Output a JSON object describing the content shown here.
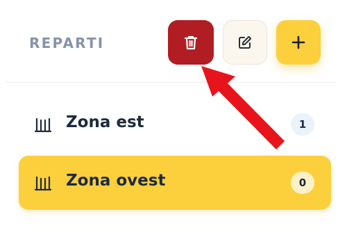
{
  "header": {
    "title": "REPARTI",
    "delete_icon": "trash-icon",
    "edit_icon": "pencil-icon",
    "add_icon": "plus-icon",
    "delete_color": "#b01d23",
    "add_color": "#fcd03d"
  },
  "departments": [
    {
      "label": "Zona est",
      "count": "1",
      "icon": "warehouse-icon",
      "selected": false
    },
    {
      "label": "Zona ovest",
      "count": "0",
      "icon": "warehouse-icon",
      "selected": true
    }
  ],
  "annotation": {
    "arrow_color": "#e8141b",
    "target": "delete-button"
  }
}
